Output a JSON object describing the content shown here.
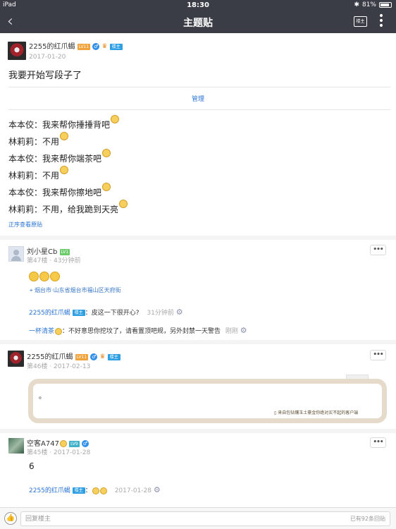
{
  "status_bar": {
    "device": "iPad",
    "time": "18:30",
    "battery": "81%"
  },
  "nav": {
    "back_glyph": "‹",
    "title": "主题贴",
    "owner_only_button": "楼主",
    "more_glyph": "⋮"
  },
  "main_post": {
    "author": "2255的红爪蝎",
    "level": "LV11",
    "badge": "楼主",
    "date": "2017-01-20",
    "title": "我要开始写段子了",
    "manage_label": "管理",
    "lines": [
      {
        "text": "本本佼：我来帮你捶捶背吧",
        "emoji": true
      },
      {
        "text": "林莉莉：不用",
        "emoji": true
      },
      {
        "text": "本本佼：我来帮你端茶吧",
        "emoji": true
      },
      {
        "text": "林莉莉：不用",
        "emoji": true
      },
      {
        "text": "本本佼：我来帮你擦地吧",
        "emoji": true
      },
      {
        "text": "林莉莉：不用，给我跪到天亮",
        "emoji": true
      }
    ],
    "view_original": "正序查看原贴"
  },
  "replies": [
    {
      "author": "刘小星Cb",
      "level": "LV1",
      "floor_time": "第47楼 · 43分钟前",
      "more": "•••",
      "location": "烟台市·山东省烟台市福山区天府街",
      "sub_replies": [
        {
          "author": "2255的红爪蝎",
          "badge": "楼主",
          "text": "：皮这一下很开心?",
          "time": "31分钟前"
        },
        {
          "author": "一杯清茶",
          "text": "：不好意思你挖坟了，请看置顶吧规，另外封禁一天警告",
          "time": "刚刚"
        }
      ]
    },
    {
      "author": "2255的红爪蝎",
      "level": "LV11",
      "badge": "楼主",
      "floor_time": "第46楼 · 2017-02-13",
      "more": "•••",
      "card_text": "。",
      "card_footer": "来自包钻镶玉土豪金你绝对买不起的客户端"
    },
    {
      "author": "空客A747",
      "level": "LV9",
      "floor_time": "第45楼 · 2017-01-28",
      "more": "•••",
      "content": "6",
      "sub_replies": [
        {
          "author": "2255的红爪蝎",
          "badge": "楼主",
          "text": "：",
          "time": "2017-01-28"
        }
      ]
    }
  ],
  "bottom": {
    "like_icon": "👍",
    "reply_placeholder": "回复楼主",
    "reply_count": "已有92条回贴"
  }
}
